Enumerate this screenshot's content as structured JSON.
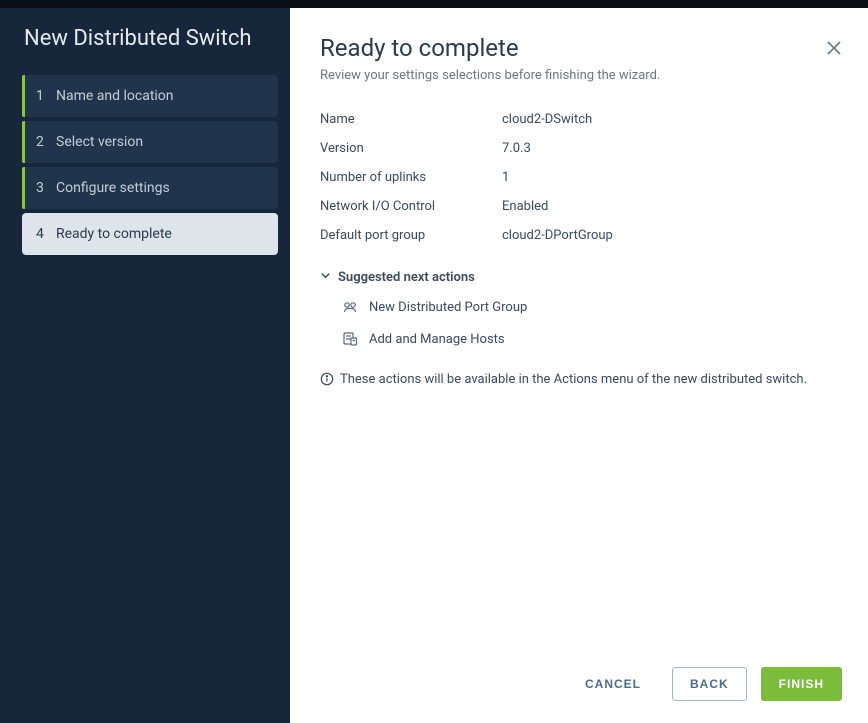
{
  "sidebar": {
    "title": "New Distributed Switch",
    "steps": [
      {
        "num": "1",
        "label": "Name and location"
      },
      {
        "num": "2",
        "label": "Select version"
      },
      {
        "num": "3",
        "label": "Configure settings"
      },
      {
        "num": "4",
        "label": "Ready to complete"
      }
    ]
  },
  "main": {
    "title": "Ready to complete",
    "subtitle": "Review your settings selections before finishing the wizard.",
    "summary": [
      {
        "label": "Name",
        "value": "cloud2-DSwitch"
      },
      {
        "label": "Version",
        "value": "7.0.3"
      },
      {
        "label": "Number of uplinks",
        "value": "1"
      },
      {
        "label": "Network I/O Control",
        "value": "Enabled"
      },
      {
        "label": "Default port group",
        "value": "cloud2-DPortGroup"
      }
    ],
    "nextActionsHeader": "Suggested next actions",
    "nextActions": [
      {
        "label": "New Distributed Port Group"
      },
      {
        "label": "Add and Manage Hosts"
      }
    ],
    "infoNote": "These actions will be available in the Actions menu of the new distributed switch."
  },
  "footer": {
    "cancel": "CANCEL",
    "back": "BACK",
    "finish": "FINISH"
  }
}
